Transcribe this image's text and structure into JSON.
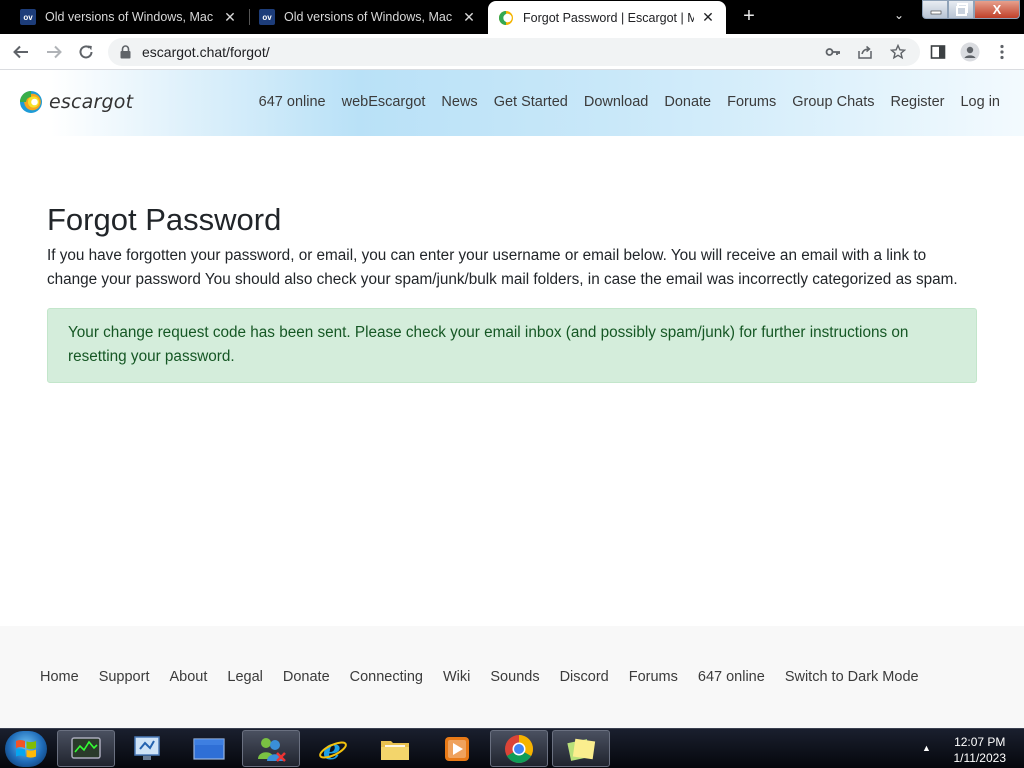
{
  "browser": {
    "tabs": [
      {
        "favicon": "ov-icon",
        "favicon_text": "ov",
        "title": "Old versions of Windows, Mac an"
      },
      {
        "favicon": "ov-icon",
        "favicon_text": "ov",
        "title": "Old versions of Windows, Mac an"
      },
      {
        "favicon": "escargot-icon",
        "title": "Forgot Password | Escargot | MSN"
      }
    ],
    "url": "escargot.chat/forgot/",
    "window_close_glyph": "X"
  },
  "site": {
    "logo_text": "escargot",
    "nav": [
      "647 online",
      "webEscargot",
      "News",
      "Get Started",
      "Download",
      "Donate",
      "Forums",
      "Group Chats",
      "Register",
      "Log in"
    ]
  },
  "main": {
    "title": "Forgot Password",
    "description": "If you have forgotten your password, or email, you can enter your username or email below. You will receive an email with a link to change your password You should also check your spam/junk/bulk mail folders, in case the email was incorrectly categorized as spam.",
    "alert": "Your change request code has been sent. Please check your email inbox (and possibly spam/junk) for further instructions on resetting your password."
  },
  "footer": {
    "links": [
      "Home",
      "Support",
      "About",
      "Legal",
      "Donate",
      "Connecting",
      "Wiki",
      "Sounds",
      "Discord",
      "Forums",
      "647 online",
      "Switch to Dark Mode"
    ]
  },
  "taskbar": {
    "time": "12:07 PM",
    "date": "1/11/2023",
    "apps": [
      "task-manager-icon",
      "control-panel-icon",
      "desktop-icon",
      "messenger-icon",
      "internet-explorer-icon",
      "file-explorer-icon",
      "media-player-icon",
      "chrome-icon",
      "sticky-notes-icon"
    ]
  },
  "colors": {
    "alert_bg": "#d4eddb",
    "alert_text": "#155724",
    "header_gradient": "#b9e1f7"
  }
}
